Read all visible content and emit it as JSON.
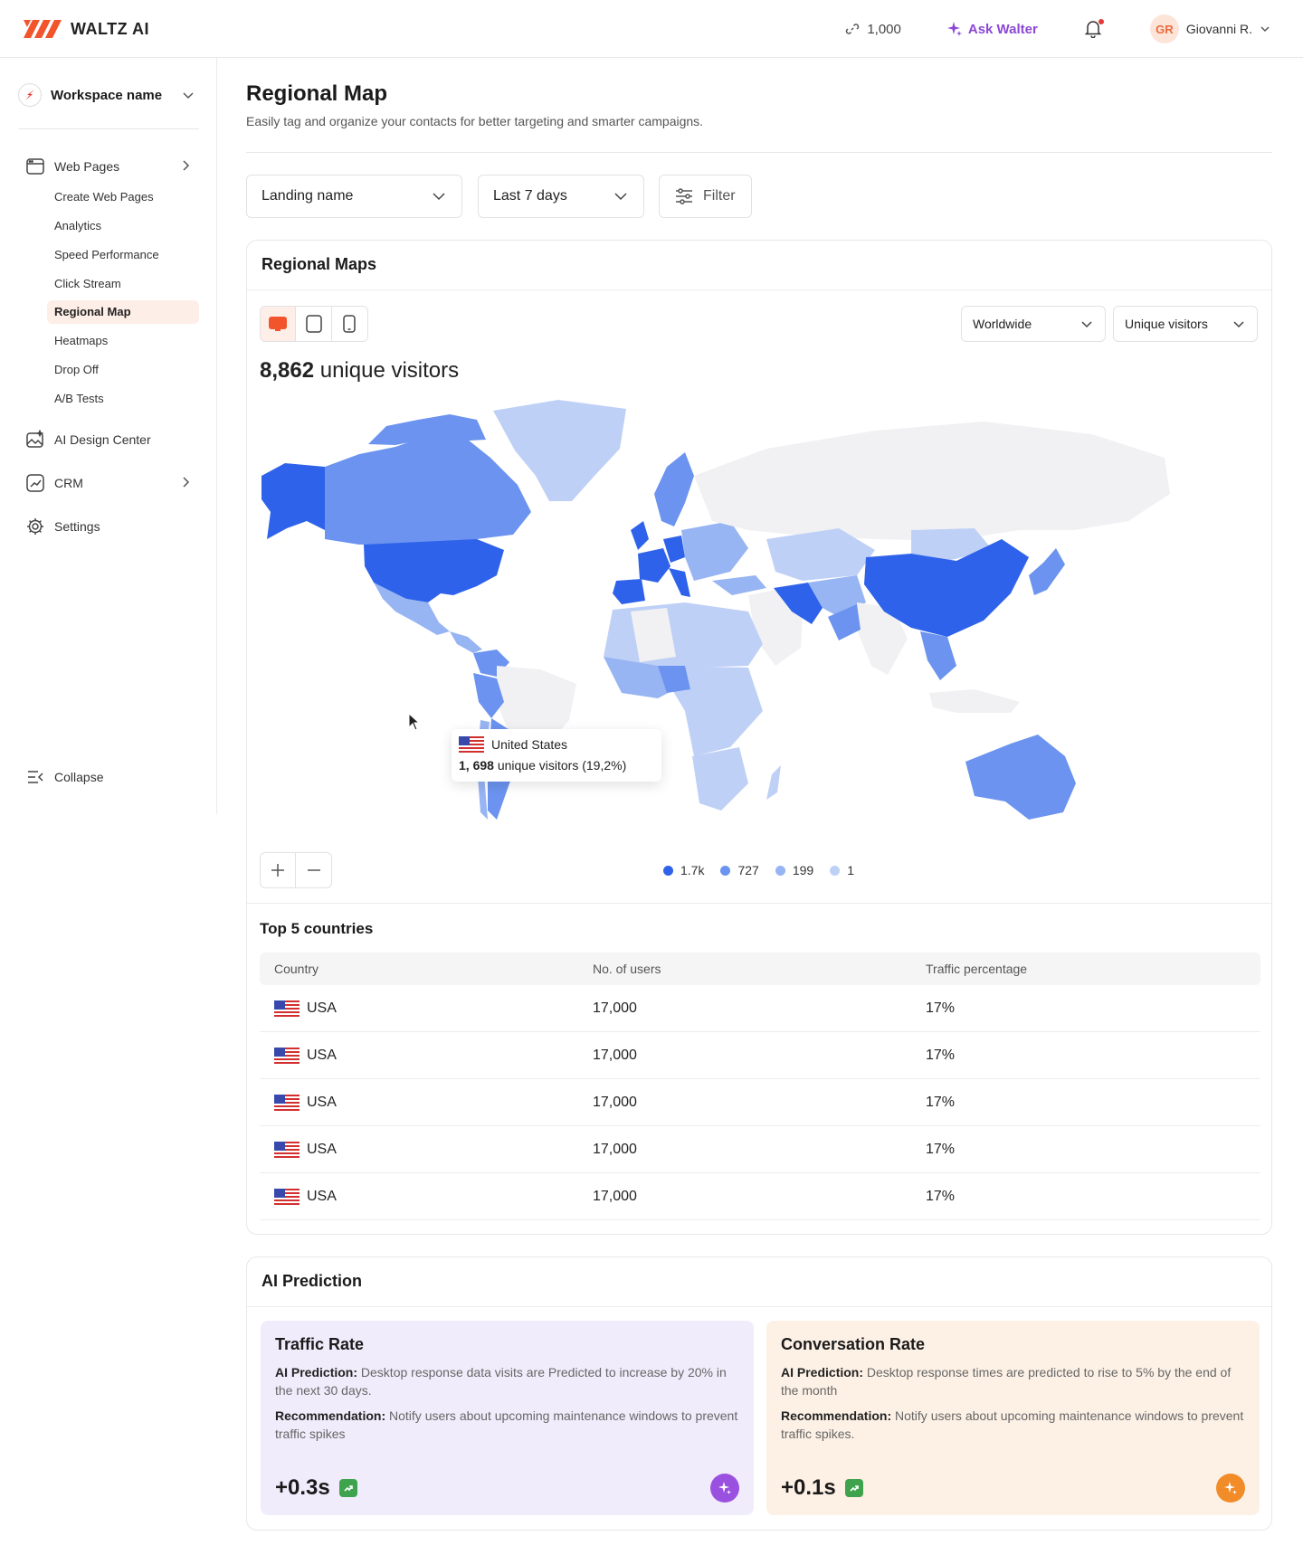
{
  "brand": {
    "name": "WALTZ AI",
    "accent": "#f2552c"
  },
  "topbar": {
    "credits": "1,000",
    "ask_label": "Ask Walter",
    "user_initials": "GR",
    "user_name": "Giovanni R."
  },
  "sidebar": {
    "workspace": "Workspace name",
    "web_pages": "Web Pages",
    "sub_items": [
      "Create Web Pages",
      "Analytics",
      "Speed Performance",
      "Click Stream",
      "Regional Map",
      "Heatmaps",
      "Drop Off",
      "A/B Tests"
    ],
    "active_sub": "Regional Map",
    "ai_design": "AI Design Center",
    "crm": "CRM",
    "settings": "Settings",
    "collapse": "Collapse"
  },
  "page": {
    "title": "Regional Map",
    "subtitle": "Easily tag and organize your contacts for better targeting and smarter campaigns."
  },
  "filters": {
    "landing": "Landing name",
    "range": "Last 7 days",
    "filter_label": "Filter"
  },
  "map_card": {
    "title": "Regional Maps",
    "region": "Worldwide",
    "metric": "Unique visitors",
    "visitors_count": "8,862",
    "visitors_label": "unique visitors",
    "tooltip": {
      "country": "United States",
      "count": "1, 698",
      "suffix": "unique visitors (19,2%)"
    },
    "legend": [
      {
        "label": "1.7k",
        "color": "#2f62ea"
      },
      {
        "label": "727",
        "color": "#6b93ef"
      },
      {
        "label": "199",
        "color": "#97b4f3"
      },
      {
        "label": "1",
        "color": "#bfd0f7"
      }
    ]
  },
  "top5": {
    "title": "Top 5 countries",
    "headers": [
      "Country",
      "No. of users",
      "Traffic percentage"
    ],
    "rows": [
      {
        "country": "USA",
        "users": "17,000",
        "pct": "17%"
      },
      {
        "country": "USA",
        "users": "17,000",
        "pct": "17%"
      },
      {
        "country": "USA",
        "users": "17,000",
        "pct": "17%"
      },
      {
        "country": "USA",
        "users": "17,000",
        "pct": "17%"
      },
      {
        "country": "USA",
        "users": "17,000",
        "pct": "17%"
      }
    ]
  },
  "ai_prediction": {
    "title": "AI Prediction",
    "cards": [
      {
        "title": "Traffic Rate",
        "pred_label": "AI Prediction:",
        "pred_text": "Desktop response data visits are Predicted to increase by 20% in the next 30 days.",
        "rec_label": "Recommendation:",
        "rec_text": "Notify users about upcoming maintenance windows to prevent traffic spikes",
        "value": "+0.3s",
        "bg": "#f1ecfb",
        "badge": "#9b51e0"
      },
      {
        "title": "Conversation Rate",
        "pred_label": "AI Prediction:",
        "pred_text": "Desktop response times are predicted to rise to 5% by the end of the month",
        "rec_label": "Recommendation:",
        "rec_text": "Notify users about upcoming maintenance windows to prevent traffic spikes.",
        "value": "+0.1s",
        "bg": "#fdf1e6",
        "badge": "#f28c28"
      }
    ]
  }
}
